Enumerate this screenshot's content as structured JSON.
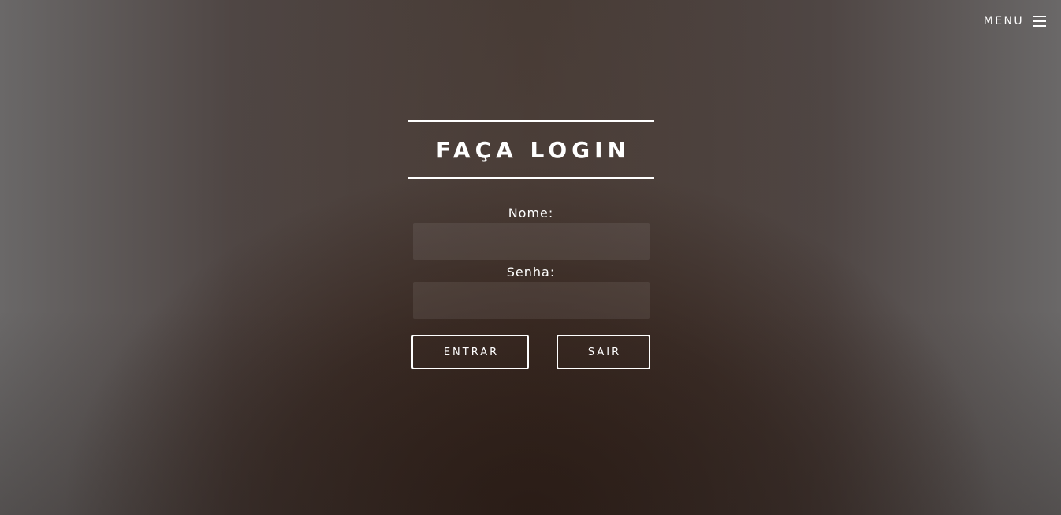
{
  "header": {
    "menu_label": "MENU",
    "menu_icon": "hamburger-icon"
  },
  "login": {
    "title": "FAÇA LOGIN",
    "name_label": "Nome:",
    "name_value": "",
    "password_label": "Senha:",
    "password_value": "",
    "submit_label": "ENTRAR",
    "exit_label": "SAIR"
  },
  "colors": {
    "text": "#ffffff",
    "background_center": "#2e1c14",
    "background_edges": "#6a6868",
    "input_fill": "#524843"
  }
}
